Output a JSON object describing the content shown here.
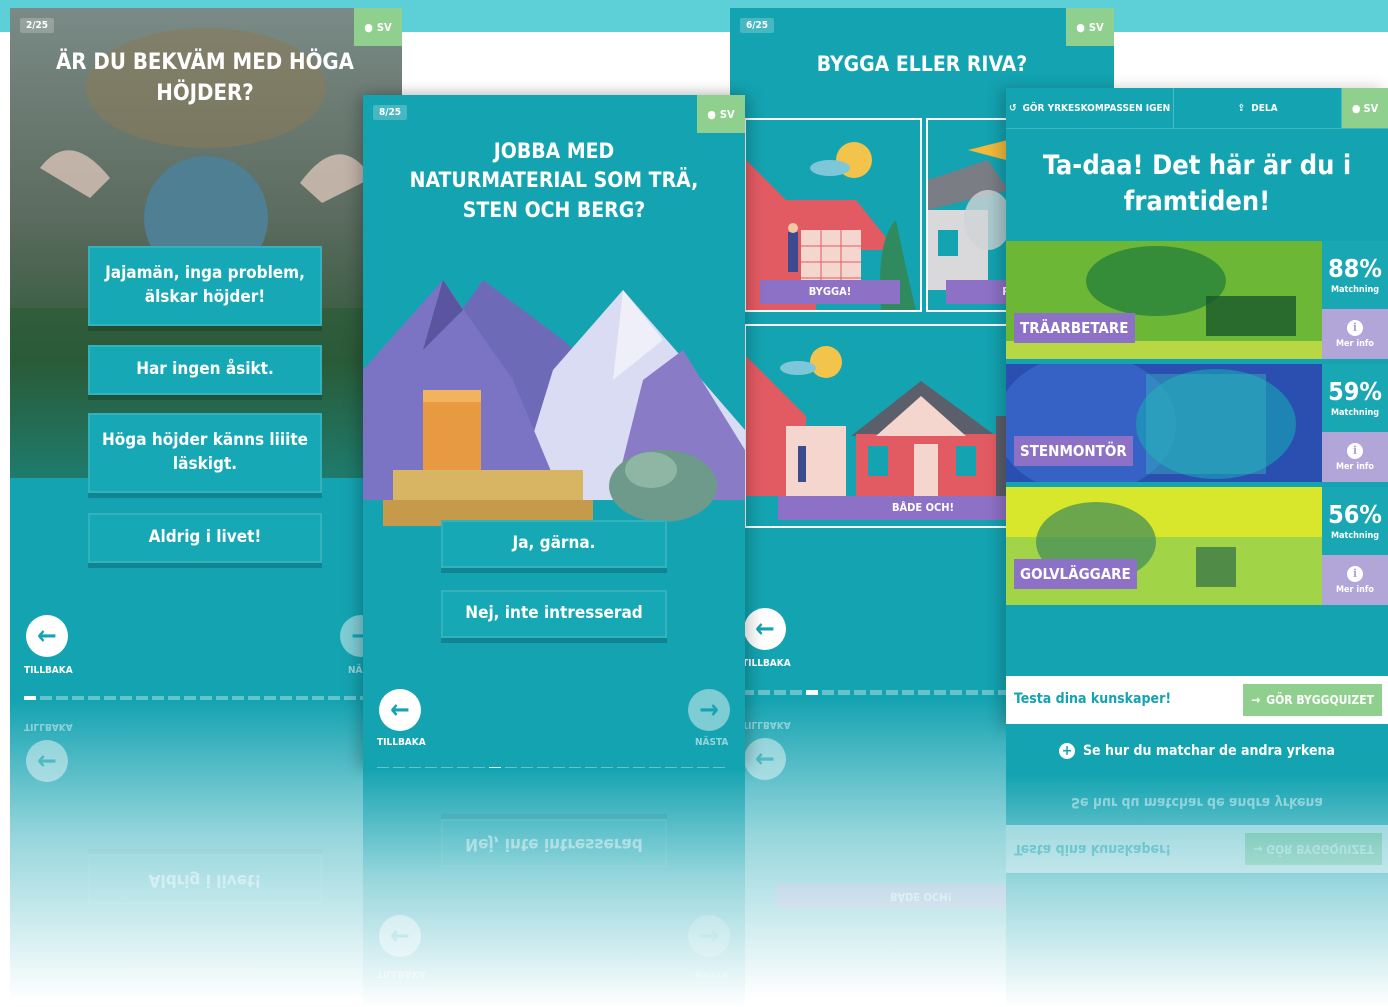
{
  "screen1": {
    "counter": "2/25",
    "lang": "SV",
    "title_line1": "ÄR DU BEKVÄM MED HÖGA",
    "title_line2": "HÖJDER?",
    "answers": [
      "Jajamän, inga problem, älskar höjder!",
      "Har ingen åsikt.",
      "Höga höjder känns liiite läskigt.",
      "Aldrig i livet!"
    ],
    "back_label": "TILLBAKA",
    "next_label": "NÄ"
  },
  "screen2": {
    "counter": "8/25",
    "lang": "SV",
    "title_line1": "JOBBA MED",
    "title_line2": "NATURMATERIAL SOM TRÄ,",
    "title_line3": "STEN OCH BERG?",
    "answers": [
      "Ja, gärna.",
      "Nej, inte intresserad"
    ],
    "back_label": "TILLBAKA",
    "next_label": "NÄSTA"
  },
  "screen3": {
    "counter": "6/25",
    "lang": "SV",
    "title": "BYGGA ELLER RIVA?",
    "options": [
      "BYGGA!",
      "R",
      "BÅDE OCH!"
    ],
    "back_label": "TILLBAKA"
  },
  "screen4": {
    "redo_label": "GÖR YRKESKOMPASSEN IGEN",
    "share_label": "DELA",
    "lang": "SV",
    "title_line1": "Ta-daa! Det här är du i",
    "title_line2": "framtiden!",
    "results": [
      {
        "name": "TRÄARBETARE",
        "percent": "88%",
        "match_label": "Matchning",
        "info_label": "Mer info",
        "match_value": 88
      },
      {
        "name": "STENMONTÖR",
        "percent": "59%",
        "match_label": "Matchning",
        "info_label": "Mer info",
        "match_value": 59
      },
      {
        "name": "GOLVLÄGGARE",
        "percent": "56%",
        "match_label": "Matchning",
        "info_label": "Mer info",
        "match_value": 56
      }
    ],
    "quiz_prompt": "Testa dina kunskaper!",
    "quiz_button": "GÖR BYGGQUIZET",
    "see_more": "Se hur du matchar de andra yrkena"
  },
  "colors": {
    "teal": "#14a3b1",
    "green": "#8fd08f",
    "purple": "#8d71c6",
    "lavender": "#b2a6d8"
  }
}
